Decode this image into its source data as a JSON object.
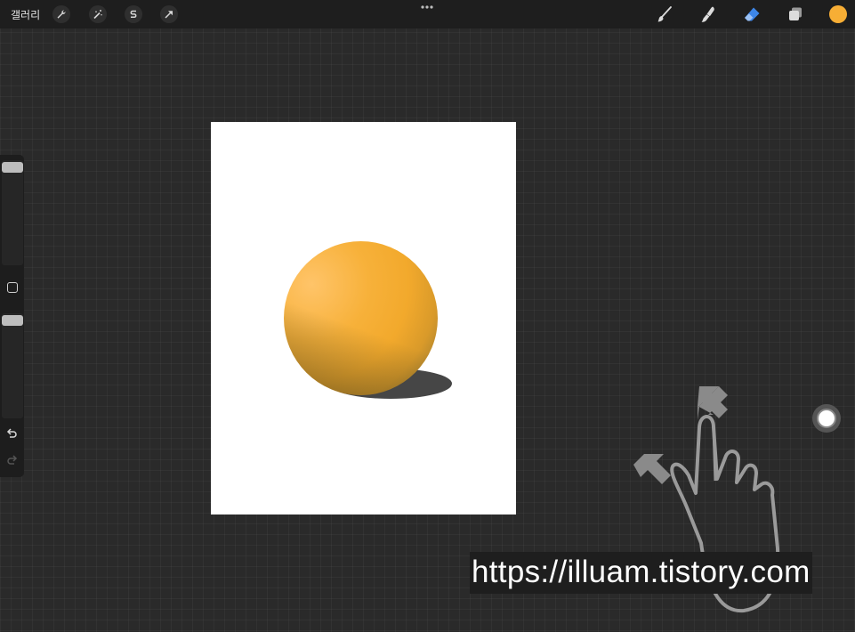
{
  "app": {
    "gallery_label": "갤러리"
  },
  "toolbar_left": [
    {
      "icon": "wrench-icon",
      "name": "actions"
    },
    {
      "icon": "magic-wand-icon",
      "name": "adjustments"
    },
    {
      "icon": "selection-s-icon",
      "name": "selection"
    },
    {
      "icon": "transform-arrow-icon",
      "name": "transform"
    }
  ],
  "toolbar_right": [
    {
      "icon": "brush-icon",
      "name": "brush"
    },
    {
      "icon": "smudge-icon",
      "name": "smudge"
    },
    {
      "icon": "eraser-icon",
      "name": "eraser",
      "active": true
    },
    {
      "icon": "layers-icon",
      "name": "layers"
    }
  ],
  "colors": {
    "current_color": "#f7ae35",
    "active_tool": "#3d86e8",
    "sphere": "#f4ad33",
    "shadow": "#464646"
  },
  "sidebar": {
    "icons": [
      "modify-square-icon",
      "undo-icon",
      "redo-icon"
    ]
  },
  "watermark": {
    "text": "https://illuam.tistory.com"
  },
  "gesture": {
    "icon": "pinch-hand-icon",
    "arrows": [
      "arrow-up-right-icon",
      "arrow-down-left-icon"
    ]
  }
}
